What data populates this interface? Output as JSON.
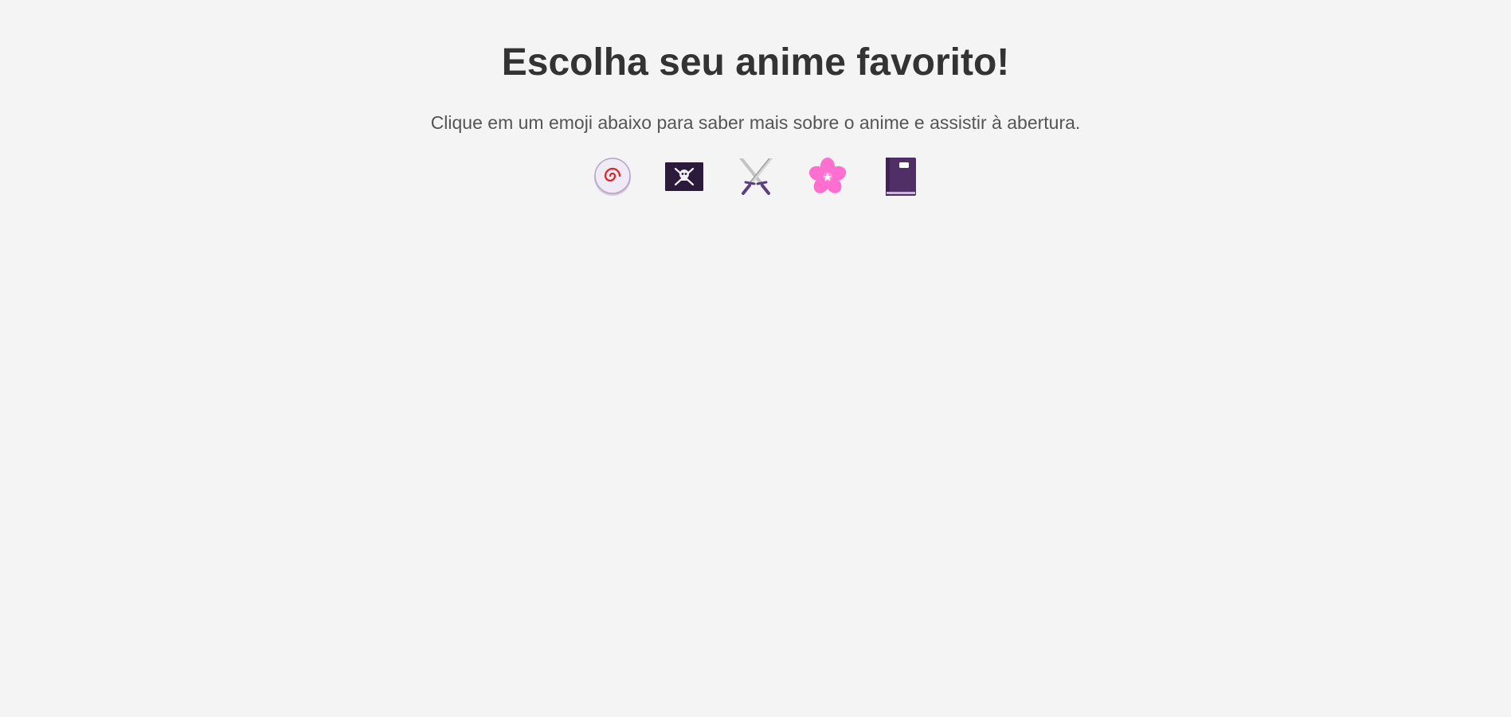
{
  "page": {
    "title": "Escolha seu anime favorito!",
    "subtitle": "Clique em um emoji abaixo para saber mais sobre o anime e assistir à abertura."
  },
  "emojis": [
    {
      "icon": "fishcake-swirl-icon",
      "label": "🍥"
    },
    {
      "icon": "pirate-flag-icon",
      "label": "🏴‍☠️"
    },
    {
      "icon": "crossed-swords-icon",
      "label": "⚔️"
    },
    {
      "icon": "cherry-blossom-icon",
      "label": "🌸"
    },
    {
      "icon": "notebook-icon",
      "label": "📓"
    }
  ],
  "colors": {
    "background": "#f4f4f4",
    "title": "#333333",
    "subtitle": "#555555",
    "swirl": "#e0242b",
    "flag": "#2b1a3a",
    "blossom": "#ff6fcf",
    "book": "#4f2f66"
  }
}
